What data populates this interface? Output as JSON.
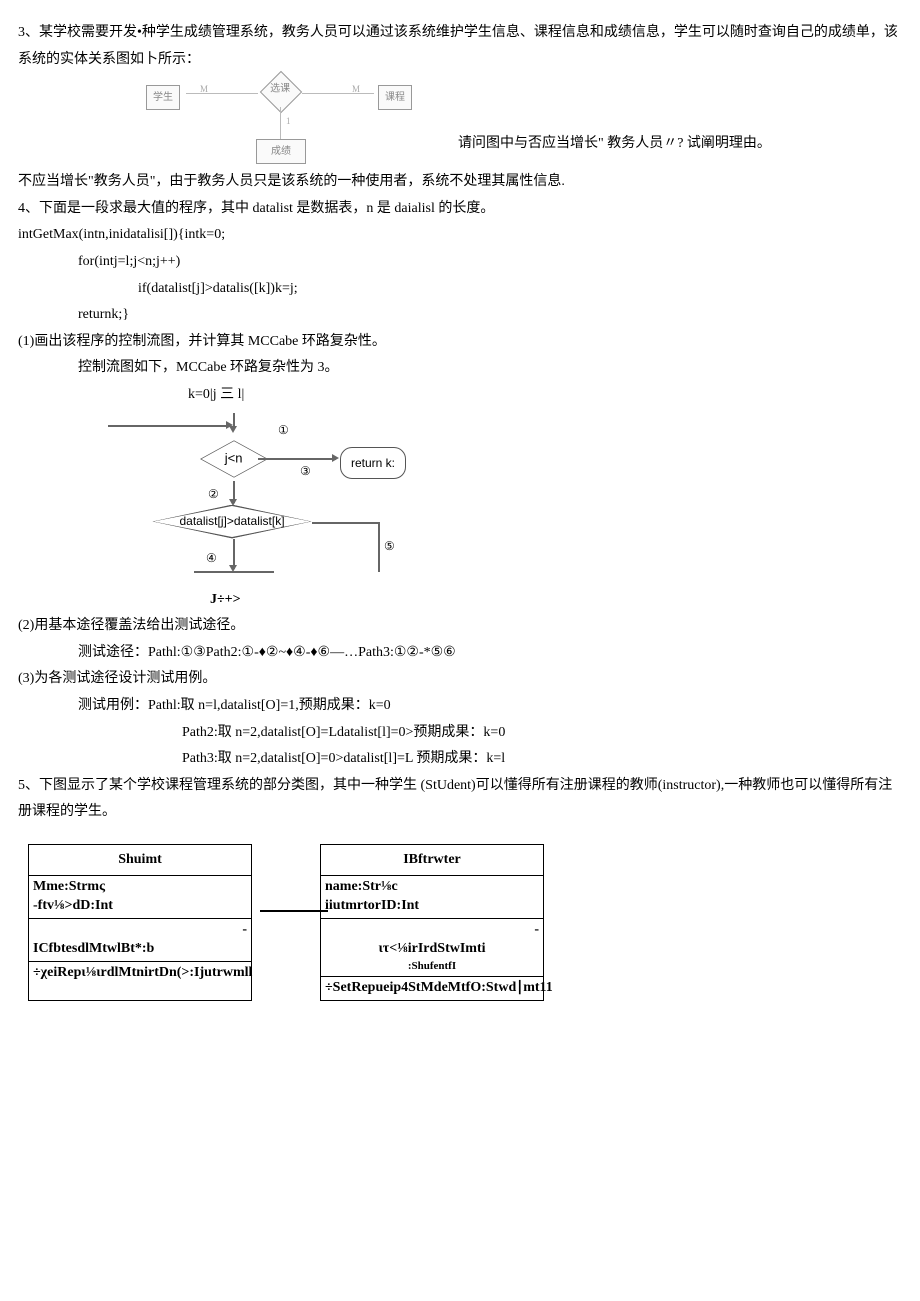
{
  "q3": {
    "prompt": "3、某学校需要开发•种学生成绩管理系统，教务人员可以通过该系统维护学生信息、课程信息和成绩信息，学生可以随时查询自己的成绩单，该系统的实体关系图如卜所示：",
    "er": {
      "left": "学生",
      "mid": "选课",
      "right": "课程",
      "bottom": "成绩",
      "m1": "M",
      "m2": "M",
      "one": "1"
    },
    "caption": "请问图中与否应当增长\" 教务人员〃? 试阐明理由。",
    "answer": "不应当增长\"教务人员\"，由于教务人员只是该系统的一种使用者，系统不处理其属性信息."
  },
  "q4": {
    "prompt": "4、下面是一段求最大值的程序，其中 datalist 是数据表，n 是 daialisl  的长度。",
    "code1": "intGetMax(intn,inidatalisi[]){intk=0;",
    "code2": "for(intj=l;j<n;j++)",
    "code3": "if(datalist[j]>datalis([k])k=j;",
    "code4": "returnk;}",
    "p1": "(1)画出该程序的控制流图，并计算其 MCCabe 环路复杂性。",
    "p1ans": "控制流图如下，MCCabe 环路复杂性为 3。",
    "flow": {
      "title": "k=0|j 三 l|",
      "n1": "①",
      "d1": "j<n",
      "n3": "③",
      "ret": "return k:",
      "n2": "②",
      "d2": "datalist[j]>datalist[k]",
      "n4": "④",
      "n5": "⑤",
      "bottom": "J÷+>"
    },
    "p2": "(2)用基本途径覆盖法给出测试途径。",
    "p2ans": "测试途径：Pathl:①③Path2:①-♦②~♦④-♦⑥—…Path3:①②-*⑤⑥",
    "p3": "(3)为各测试途径设计测试用例。",
    "p3ans1": "测试用例：Pathl:取 n=l,datalist[O]=1,预期成果：k=0",
    "p3ans2": "Path2:取 n=2,datalist[O]=Ldatalist[l]=0>预期成果：k=0",
    "p3ans3": "Path3:取 n=2,datalist[O]=0>datalist[l]=L 预期成果：k=l"
  },
  "q5": {
    "prompt": "5、下图显示了某个学校课程管理系统的部分类图，其中一种学生 (StUdent)可以懂得所有注册课程的教师(instructor),一种教师也可以懂得所有注册课程的学生。",
    "left": {
      "title": "Shuimt",
      "a1": "Mme:Strmς",
      "a2": "-ftv⅛>dD:Int",
      "m1d": "-",
      "m1": "ICfbtesdlMtwlBt*:b",
      "m2": "÷χeiRepι⅛ιrdlMtnirtDn(>:Ijutrwmll"
    },
    "right": {
      "title": "IBftrwter",
      "a1": "name:Str⅛c",
      "a2": "iiutmrtorID:Int",
      "m1d": "-",
      "m1": "ιτ<⅛irIrdStwImti",
      "m1b": ":ShufentfI",
      "m2": "÷SetRepueip4StMdeMtfO:Stwd∣mt11"
    }
  }
}
